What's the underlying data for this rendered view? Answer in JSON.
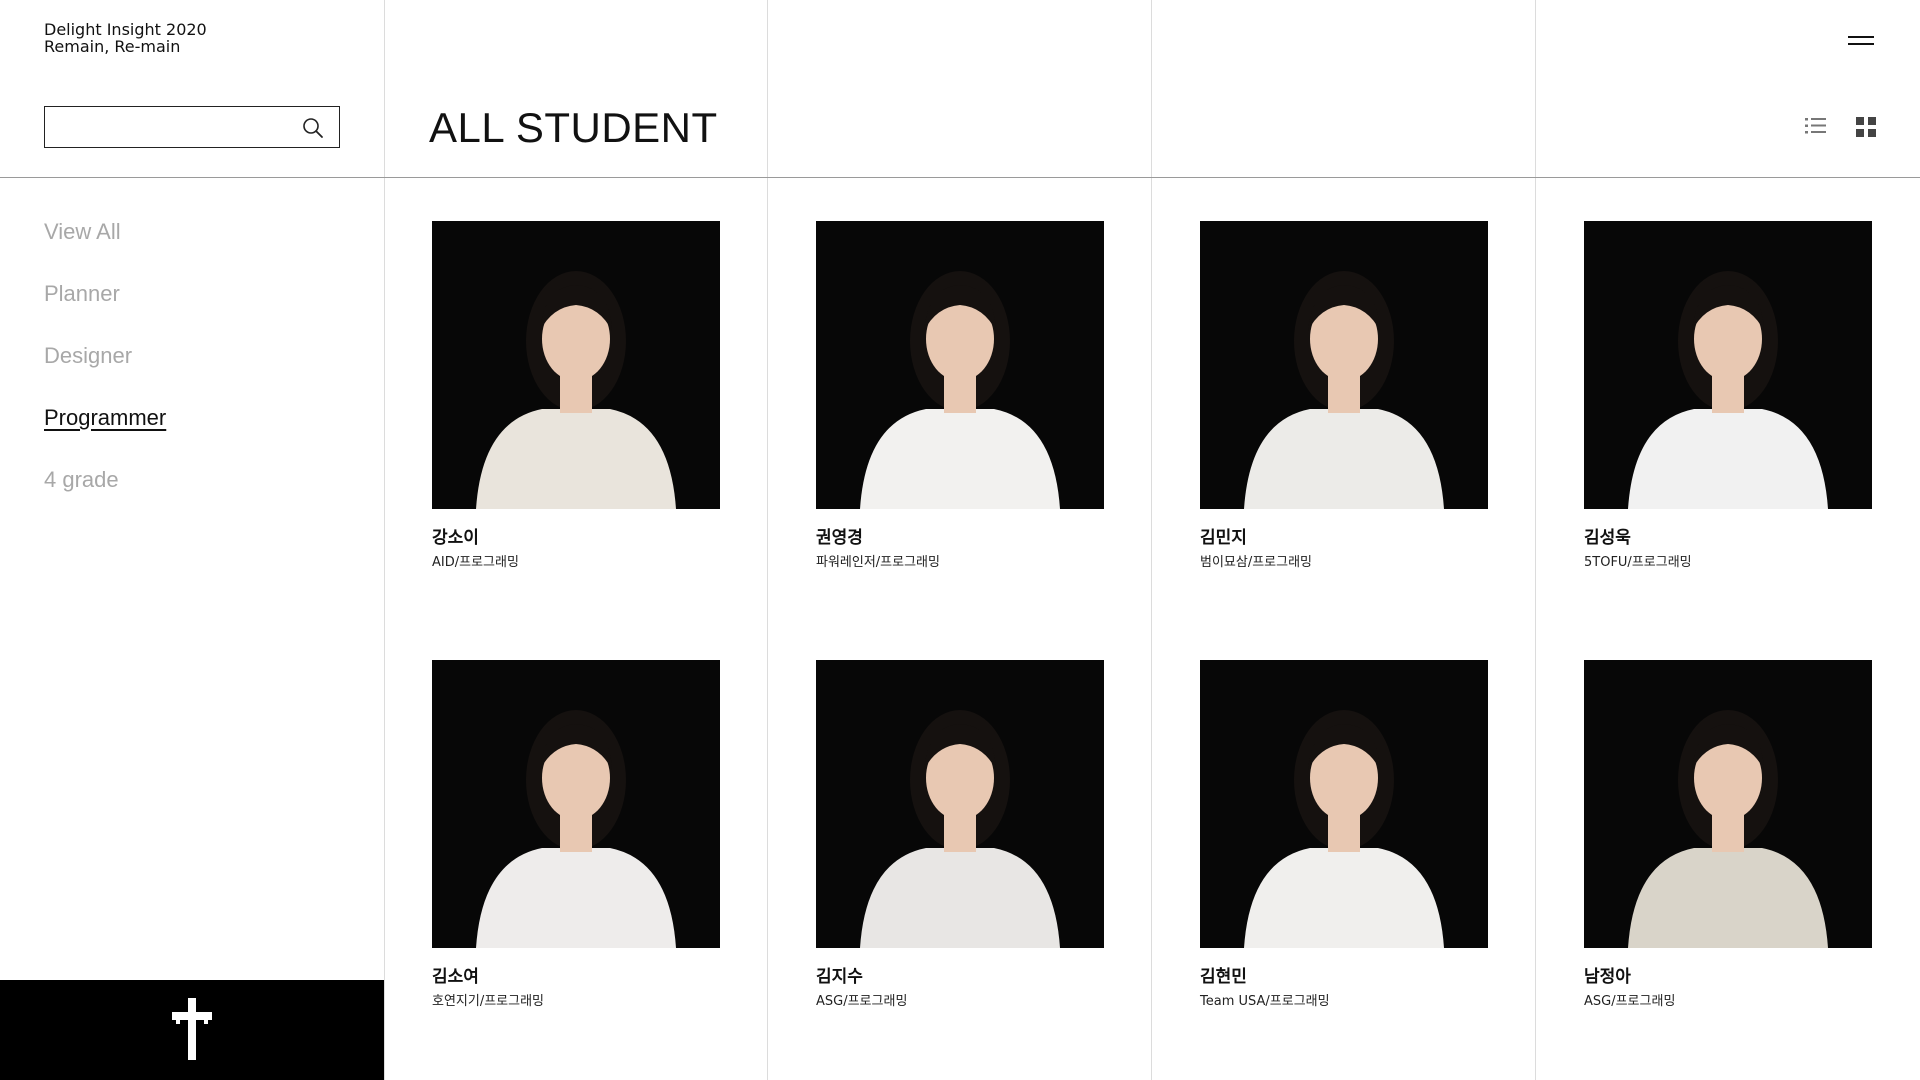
{
  "brand": {
    "line1": "Delight Insight 2020",
    "line2": "Remain, Re-main"
  },
  "search": {
    "value": "",
    "placeholder": "",
    "icon": "search-icon"
  },
  "nav": {
    "items": [
      {
        "label": "View All"
      },
      {
        "label": "Planner"
      },
      {
        "label": "Designer"
      },
      {
        "label": "Programmer",
        "active": true
      },
      {
        "label": "4 grade"
      }
    ]
  },
  "header": {
    "title": "ALL STUDENT",
    "menu_icon": "hamburger-icon",
    "list_icon": "list-view-icon",
    "grid_icon": "grid-view-icon"
  },
  "students": [
    {
      "name": "강소이",
      "team": "AID/프로그래밍",
      "shirt": "#e9e4dc"
    },
    {
      "name": "권영경",
      "team": "파워레인저/프로그래밍",
      "shirt": "#f2f1ef"
    },
    {
      "name": "김민지",
      "team": "범이묘삼/프로그래밍",
      "shirt": "#ecebe8"
    },
    {
      "name": "김성욱",
      "team": "5TOFU/프로그래밍",
      "shirt": "#f1f1f1"
    },
    {
      "name": "김소여",
      "team": "호연지기/프로그래밍",
      "shirt": "#eeeceb"
    },
    {
      "name": "김지수",
      "team": "ASG/프로그래밍",
      "shirt": "#e8e6e4"
    },
    {
      "name": "김현민",
      "team": "Team USA/프로그래밍",
      "shirt": "#f0efed"
    },
    {
      "name": "남정아",
      "team": "ASG/프로그래밍",
      "shirt": "#d9d4c9"
    }
  ],
  "colors": {
    "photo_bg": "#070707",
    "skin": "#e8c8b2",
    "hair": "#15110f",
    "nav_inactive": "#a8a8a8",
    "logo_bg": "#000000"
  }
}
